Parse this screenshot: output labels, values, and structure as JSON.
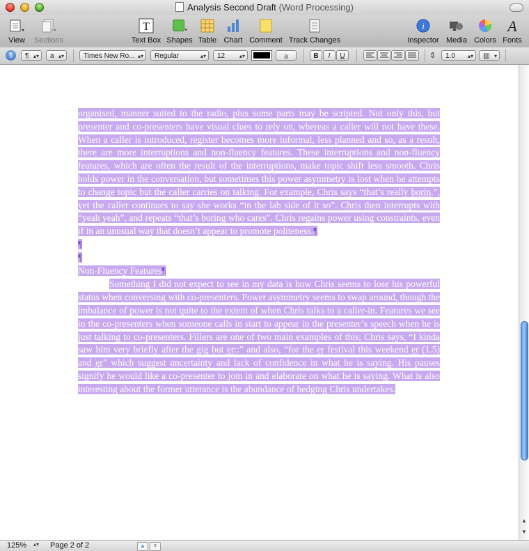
{
  "window": {
    "title": "Analysis Second Draft",
    "app_type": "(Word Processing)"
  },
  "toolbar": {
    "view": "View",
    "sections": "Sections",
    "text_box": "Text Box",
    "shapes": "Shapes",
    "table": "Table",
    "chart": "Chart",
    "comment": "Comment",
    "track_changes": "Track Changes",
    "inspector": "Inspector",
    "media": "Media",
    "colors": "Colors",
    "fonts": "Fonts"
  },
  "format_bar": {
    "paragraph_style_glyph": "¶",
    "char_style_glyph": "a",
    "font_family": "Times New Ro...",
    "font_style": "Regular",
    "font_size": "12",
    "highlight_glyph": "a",
    "bold": "B",
    "italic": "I",
    "underline": "U",
    "line_spacing": "1.0",
    "text_color": "#000000"
  },
  "document": {
    "para1_part1": "organised, manner suited to the radio, plus some parts may be scripted. Not only this, but presenter and co-presenters have visual clues to rely on, whereas a caller will not have these. When a caller is introduced, register becomes more informal, less planned and so, as a result, there are more interruptions and non-fluency features. These interruptions and non-fluency features, which are often the result of the interruptions, make topic shift less smooth. Chris holds power in the conversation, but sometimes this power asymmetry is lost when he attempts to change topic but the caller carries on talking. For example, Chris says “that’s really ",
    "para1_squiggle": "borin",
    "para1_part2": ".”, yet the caller continues to say she works “in the lab side of it so”. Chris then interrupts with “yeah yeah”, and repeats “that’s boring who cares”. Chris regains power using constraints, even if in an unusual way that doesn’t appear to promote politeness.",
    "pilcrow": "¶",
    "heading": "Non-Fluency Features",
    "para2_part1": "Something I did not expect to see in my data is how Chris seems to lose his powerful status when conversing with co-presenters. Power asymmetry seems to swap around, though the imbalance of power is not quite to the extent of when Chris talks to a caller-in. Features we see in the co-presenters when someone calls in start to appear in the presenter’s speech when he is just talking to co-presenters. Fillers are one of two main examples of this; Chris says, “I kinda saw him very briefly after the gig but ",
    "para2_sq1": "er",
    "para2_part2": "::” and also, “for the ",
    "para2_sq2": "er",
    "para2_part3": " festival this weekend ",
    "para2_sq3": "er",
    "para2_part4": " (1.5) and ",
    "para2_sq4": "er",
    "para2_part5": "” which suggest uncertainty and lack of confidence in what he is saying. His pauses signify he would like a co-presenter to join in and elaborate on what he is saying. What is also interesting about the former utterance is the abundance of hedging Chris undertakes."
  },
  "status": {
    "zoom": "125%",
    "page": "Page 2 of 2"
  }
}
